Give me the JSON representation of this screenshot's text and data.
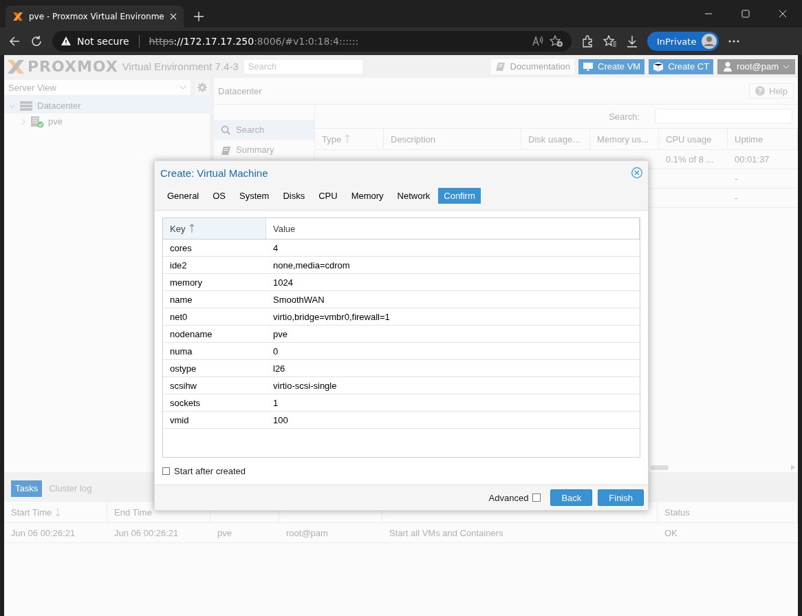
{
  "browser": {
    "tab_title": "pve - Proxmox Virtual Environme",
    "security": "Not secure",
    "url": {
      "scheme": "https",
      "host": "://172.17.17.250",
      "path": ":8006/#v1:0:18:4::::::"
    },
    "profile": "InPrivate"
  },
  "header": {
    "brand": "PROXMOX",
    "product": "Virtual Environment 7.4-3",
    "search_placeholder": "Search",
    "buttons": [
      {
        "label": "Documentation",
        "kind": "doc"
      },
      {
        "label": "Create VM",
        "kind": "vm"
      },
      {
        "label": "Create CT",
        "kind": "ct"
      }
    ],
    "user": "root@pam"
  },
  "sidebar": {
    "view": "Server View",
    "tree": [
      {
        "label": "Datacenter",
        "kind": "datacenter",
        "selected": true,
        "expanded": true,
        "children": [
          {
            "label": "pve",
            "kind": "node",
            "selected": false,
            "expanded": false
          }
        ]
      }
    ]
  },
  "content": {
    "title": "Datacenter",
    "help": "Help",
    "menu": [
      {
        "label": "Search",
        "kind": "search",
        "selected": true
      },
      {
        "label": "Summary",
        "kind": "summary",
        "selected": false
      }
    ],
    "search_label": "Search:",
    "columns": [
      {
        "label": "Type",
        "sorted_ascending": true
      },
      {
        "label": "Description",
        "sorted_ascending": false
      },
      {
        "label": "Disk usage...",
        "sorted_ascending": false
      },
      {
        "label": "Memory us...",
        "sorted_ascending": false
      },
      {
        "label": "CPU usage",
        "sorted_ascending": false
      },
      {
        "label": "Uptime",
        "sorted_ascending": false
      }
    ],
    "rows": [
      {
        "cpu": "0.1% of 8 ...",
        "uptime": "00:01:37"
      },
      {
        "uptime": "-"
      },
      {
        "uptime": "-"
      }
    ]
  },
  "dialog": {
    "title": "Create: Virtual Machine",
    "tabs": [
      {
        "label": "General",
        "selected": false
      },
      {
        "label": "OS",
        "selected": false
      },
      {
        "label": "System",
        "selected": false
      },
      {
        "label": "Disks",
        "selected": false
      },
      {
        "label": "CPU",
        "selected": false
      },
      {
        "label": "Memory",
        "selected": false
      },
      {
        "label": "Network",
        "selected": false
      },
      {
        "label": "Confirm",
        "selected": true
      }
    ],
    "columns": [
      {
        "label": "Key",
        "sorted_ascending": true
      },
      {
        "label": "Value",
        "sorted_ascending": false
      }
    ],
    "rows": [
      {
        "key": "cores",
        "value": "4"
      },
      {
        "key": "ide2",
        "value": "none,media=cdrom"
      },
      {
        "key": "memory",
        "value": "1024"
      },
      {
        "key": "name",
        "value": "SmoothWAN"
      },
      {
        "key": "net0",
        "value": "virtio,bridge=vmbr0,firewall=1"
      },
      {
        "key": "nodename",
        "value": "pve"
      },
      {
        "key": "numa",
        "value": "0"
      },
      {
        "key": "ostype",
        "value": "l26"
      },
      {
        "key": "scsihw",
        "value": "virtio-scsi-single"
      },
      {
        "key": "sockets",
        "value": "1"
      },
      {
        "key": "vmid",
        "value": "100"
      }
    ],
    "start_after_created": {
      "label": "Start after created",
      "checked": false
    },
    "advanced": {
      "label": "Advanced",
      "checked": false
    },
    "buttons": [
      "Back",
      "Finish"
    ]
  },
  "tasks": {
    "tabs": [
      {
        "label": "Tasks",
        "selected": true
      },
      {
        "label": "Cluster log",
        "selected": false
      }
    ],
    "columns": [
      {
        "label": "Start Time",
        "sorted_descending": true
      },
      {
        "label": "End Time",
        "sorted_descending": false
      },
      {
        "label": "Status",
        "sorted_descending": false
      }
    ],
    "rows": [
      {
        "start": "Jun 06 00:26:21",
        "end": "Jun 06 00:26:21",
        "node": "pve",
        "user": "root@pam",
        "description": "Start all VMs and Containers",
        "status": "OK"
      }
    ]
  }
}
